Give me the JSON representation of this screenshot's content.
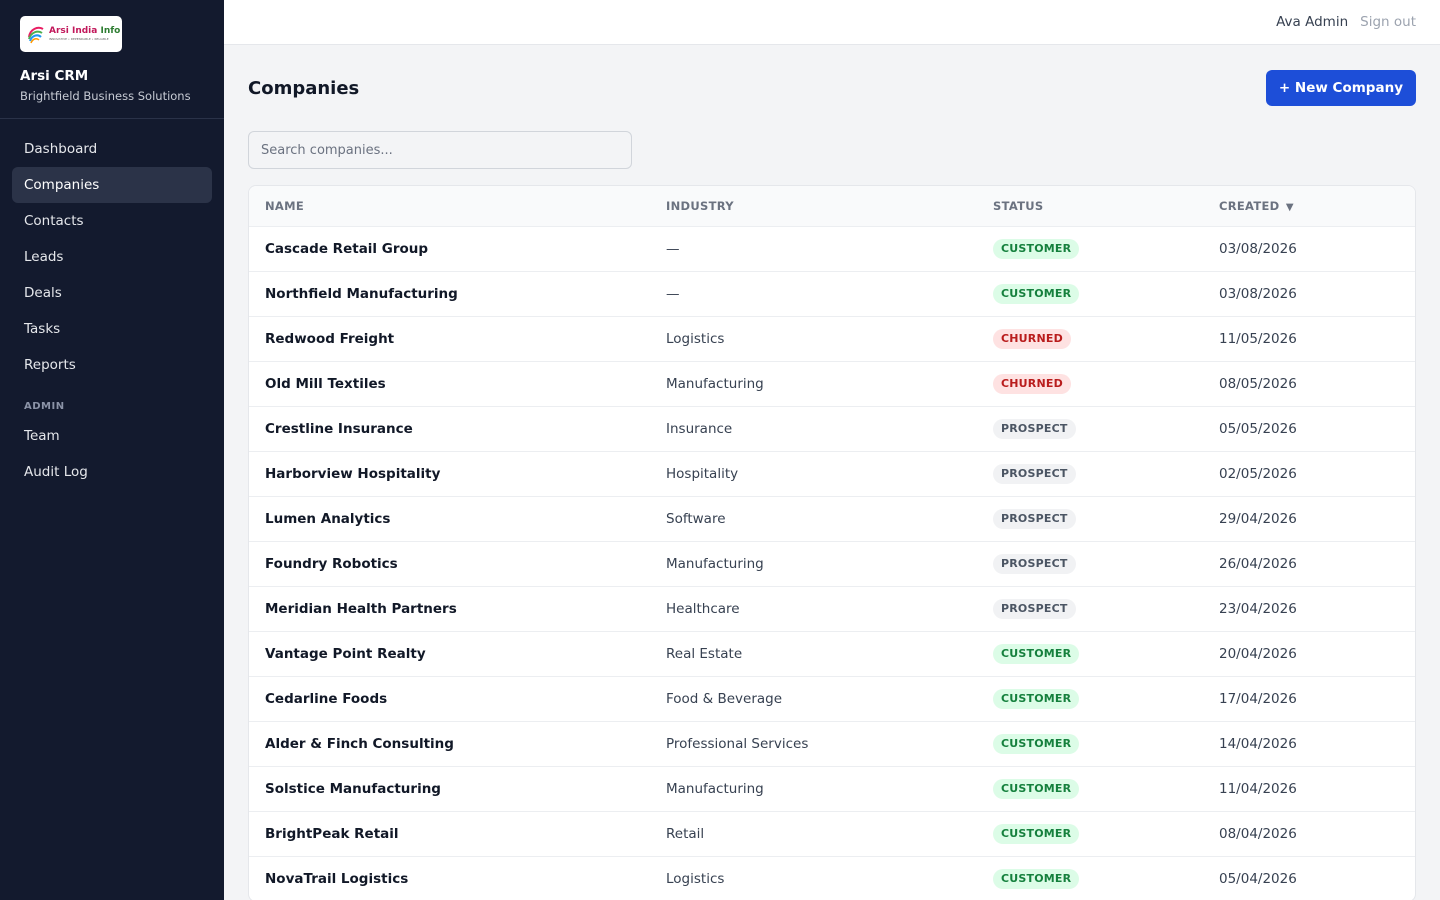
{
  "sidebar": {
    "logo": {
      "name_part1": "Arsi India",
      "name_part2": "Info",
      "tagline": "INNOVATIVE • DEPENDABLE • RELIABLE"
    },
    "app_name": "Arsi CRM",
    "org_name": "Brightfield Business Solutions",
    "items": [
      {
        "label": "Dashboard",
        "active": false
      },
      {
        "label": "Companies",
        "active": true
      },
      {
        "label": "Contacts",
        "active": false
      },
      {
        "label": "Leads",
        "active": false
      },
      {
        "label": "Deals",
        "active": false
      },
      {
        "label": "Tasks",
        "active": false
      },
      {
        "label": "Reports",
        "active": false
      }
    ],
    "admin_section_label": "ADMIN",
    "admin_items": [
      {
        "label": "Team"
      },
      {
        "label": "Audit Log"
      }
    ]
  },
  "topbar": {
    "user_name": "Ava Admin",
    "signout_label": "Sign out"
  },
  "page": {
    "title": "Companies",
    "new_button_label": "+ New Company",
    "search_placeholder": "Search companies..."
  },
  "table": {
    "columns": {
      "name": "NAME",
      "industry": "INDUSTRY",
      "status": "STATUS",
      "created": "CREATED",
      "created_sort_indicator": "▼"
    },
    "rows": [
      {
        "name": "Cascade Retail Group",
        "industry": "—",
        "status": "CUSTOMER",
        "created": "03/08/2026"
      },
      {
        "name": "Northfield Manufacturing",
        "industry": "—",
        "status": "CUSTOMER",
        "created": "03/08/2026"
      },
      {
        "name": "Redwood Freight",
        "industry": "Logistics",
        "status": "CHURNED",
        "created": "11/05/2026"
      },
      {
        "name": "Old Mill Textiles",
        "industry": "Manufacturing",
        "status": "CHURNED",
        "created": "08/05/2026"
      },
      {
        "name": "Crestline Insurance",
        "industry": "Insurance",
        "status": "PROSPECT",
        "created": "05/05/2026"
      },
      {
        "name": "Harborview Hospitality",
        "industry": "Hospitality",
        "status": "PROSPECT",
        "created": "02/05/2026"
      },
      {
        "name": "Lumen Analytics",
        "industry": "Software",
        "status": "PROSPECT",
        "created": "29/04/2026"
      },
      {
        "name": "Foundry Robotics",
        "industry": "Manufacturing",
        "status": "PROSPECT",
        "created": "26/04/2026"
      },
      {
        "name": "Meridian Health Partners",
        "industry": "Healthcare",
        "status": "PROSPECT",
        "created": "23/04/2026"
      },
      {
        "name": "Vantage Point Realty",
        "industry": "Real Estate",
        "status": "CUSTOMER",
        "created": "20/04/2026"
      },
      {
        "name": "Cedarline Foods",
        "industry": "Food & Beverage",
        "status": "CUSTOMER",
        "created": "17/04/2026"
      },
      {
        "name": "Alder & Finch Consulting",
        "industry": "Professional Services",
        "status": "CUSTOMER",
        "created": "14/04/2026"
      },
      {
        "name": "Solstice Manufacturing",
        "industry": "Manufacturing",
        "status": "CUSTOMER",
        "created": "11/04/2026"
      },
      {
        "name": "BrightPeak Retail",
        "industry": "Retail",
        "status": "CUSTOMER",
        "created": "08/04/2026"
      },
      {
        "name": "NovaTrail Logistics",
        "industry": "Logistics",
        "status": "CUSTOMER",
        "created": "05/04/2026"
      }
    ]
  },
  "colors": {
    "sidebar_bg": "#131a2e",
    "accent": "#1d4ed8",
    "customer": "#15803d",
    "churned": "#b91c1c",
    "prospect": "#4b5563"
  }
}
